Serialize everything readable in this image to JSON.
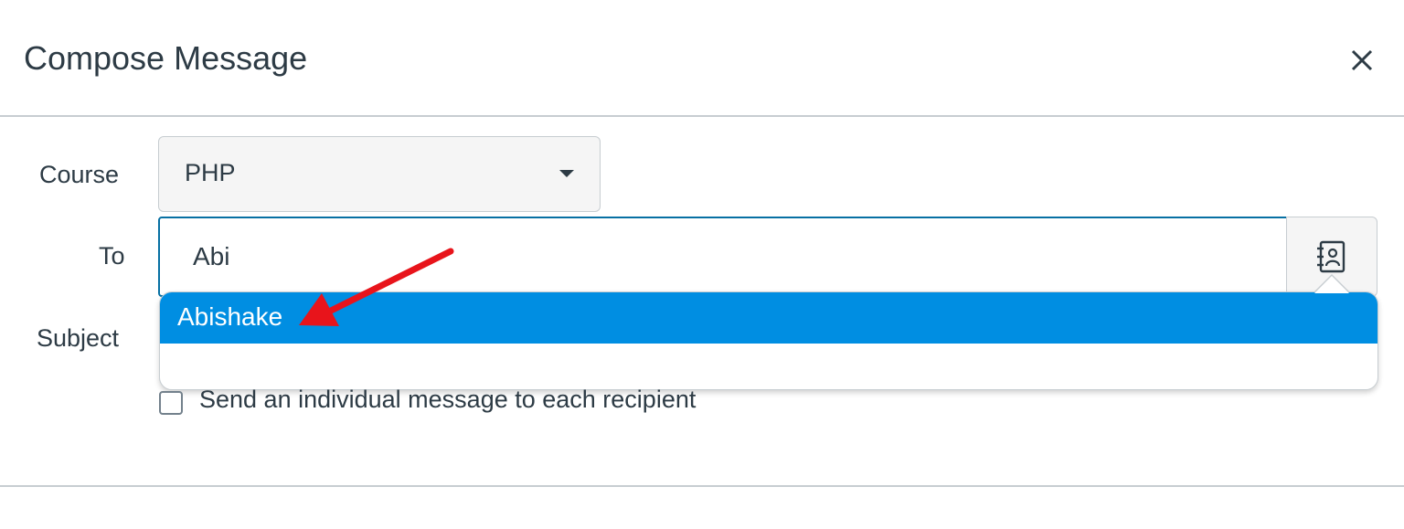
{
  "dialog": {
    "title": "Compose Message",
    "close_icon": "close-icon"
  },
  "form": {
    "course": {
      "label": "Course",
      "value": "PHP"
    },
    "to": {
      "label": "To",
      "value": "Abi",
      "address_book_icon": "address-book-icon"
    },
    "subject": {
      "label": "Subject"
    },
    "autocomplete": {
      "items": [
        "Abishake"
      ],
      "selected_index": 0
    },
    "individual_message": {
      "label": "Send an individual message to each recipient",
      "checked": false
    }
  },
  "colors": {
    "highlight": "#008ee2",
    "focus_border": "#0770a3",
    "text": "#2d3b45",
    "annotation_arrow": "#e8141b"
  }
}
